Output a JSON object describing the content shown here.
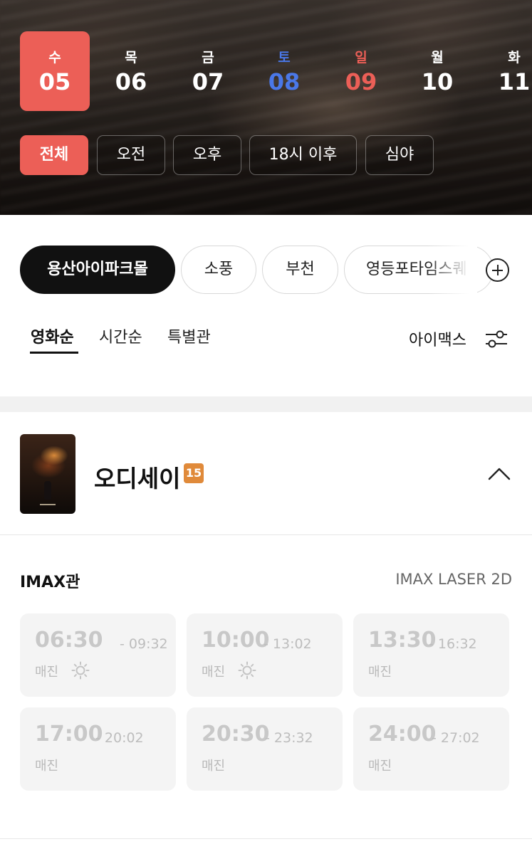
{
  "dates": [
    {
      "dow": "수",
      "day": "05",
      "type": "active"
    },
    {
      "dow": "목",
      "day": "06",
      "type": "weekday"
    },
    {
      "dow": "금",
      "day": "07",
      "type": "weekday"
    },
    {
      "dow": "토",
      "day": "08",
      "type": "sat"
    },
    {
      "dow": "일",
      "day": "09",
      "type": "sun"
    },
    {
      "dow": "월",
      "day": "10",
      "type": "weekday"
    },
    {
      "dow": "화",
      "day": "11",
      "type": "weekday"
    }
  ],
  "time_filters": [
    "전체",
    "오전",
    "오후",
    "18시 이후",
    "심야"
  ],
  "theaters": [
    "용산아이파크몰",
    "소풍",
    "부천",
    "영등포타임스퀘"
  ],
  "sort_tabs": [
    "영화순",
    "시간순",
    "특별관"
  ],
  "filter_label": "아이맥스",
  "movie": {
    "title": "오디세이",
    "rating": "15"
  },
  "screen": {
    "name": "IMAX관",
    "format": "IMAX LASER 2D"
  },
  "showtimes": [
    {
      "start": "06:30",
      "end": "- 09:32",
      "status": "매진",
      "morning_icon": true
    },
    {
      "start": "10:00",
      "end": "- 13:02",
      "status": "매진",
      "morning_icon": true
    },
    {
      "start": "13:30",
      "end": "- 16:32",
      "status": "매진",
      "morning_icon": false
    },
    {
      "start": "17:00",
      "end": "- 20:02",
      "status": "매진",
      "morning_icon": false
    },
    {
      "start": "20:30",
      "end": "- 23:32",
      "status": "매진",
      "morning_icon": false
    },
    {
      "start": "24:00",
      "end": "- 27:02",
      "status": "매진",
      "morning_icon": false
    }
  ],
  "colors": {
    "accent": "#ec5f57",
    "saturday": "#4a78e8",
    "sunday": "#ec5f57",
    "rating_15": "#e08a3a"
  }
}
